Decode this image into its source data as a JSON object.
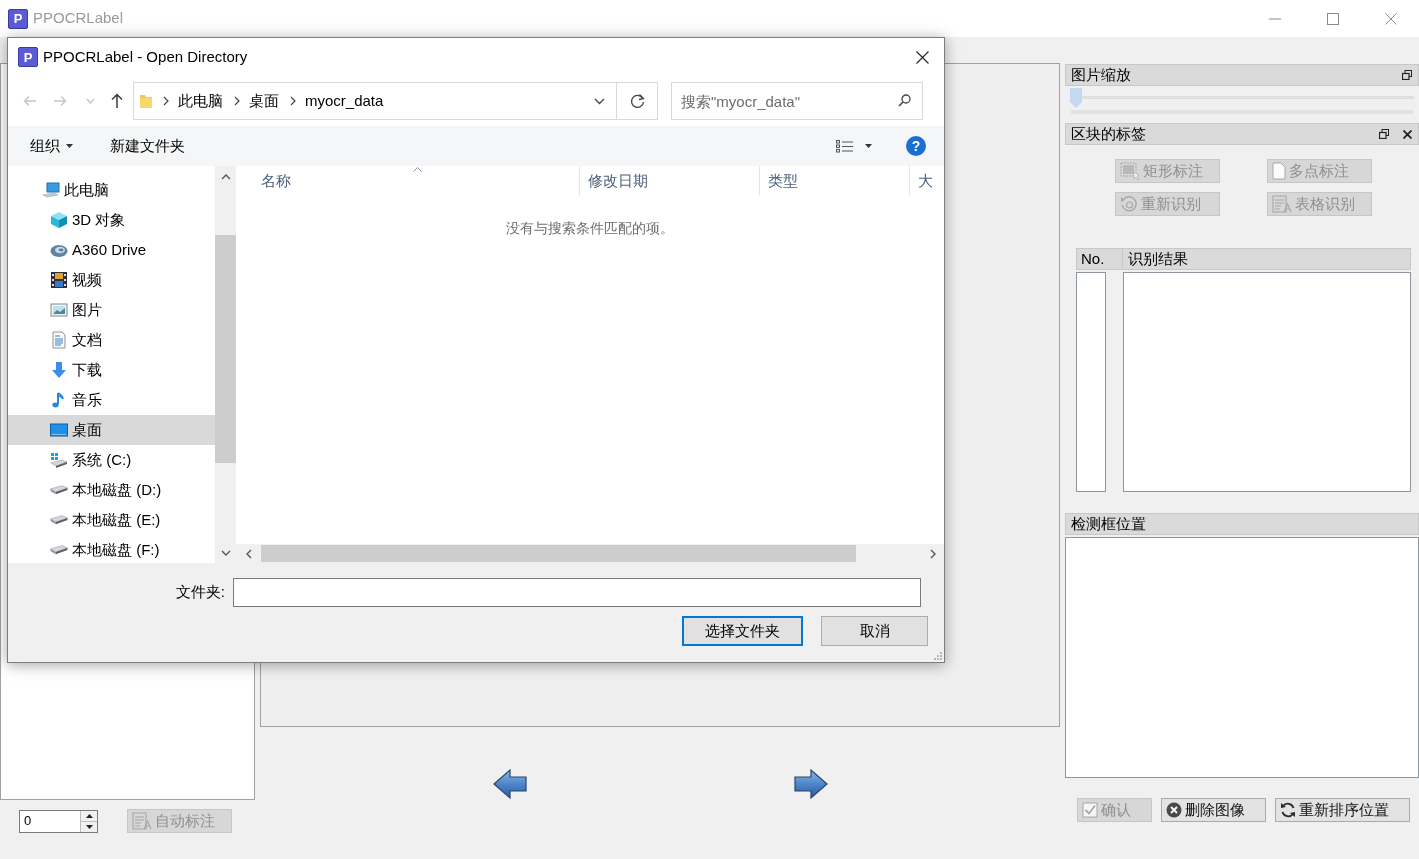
{
  "window": {
    "logo": "P",
    "title": "PPOCRLabel"
  },
  "left_panel": {
    "spinbox_value": "0",
    "auto_button": {
      "label": "自动标注",
      "disabled": true
    }
  },
  "right_panel": {
    "zoom_dock": {
      "title": "图片缩放",
      "level": 0
    },
    "labels_dock": {
      "title": "区块的标签",
      "buttons": [
        {
          "label": "矩形标注",
          "kind": "rect",
          "disabled": true
        },
        {
          "label": "多点标注",
          "kind": "poly",
          "disabled": true
        },
        {
          "label": "重新识别",
          "kind": "reocr",
          "disabled": true
        },
        {
          "label": "表格识别",
          "kind": "table",
          "disabled": true
        }
      ],
      "columns": [
        "No.",
        "识别结果"
      ]
    },
    "box_dock": {
      "title": "检测框位置"
    },
    "buttons": [
      {
        "label": "确认",
        "kind": "check",
        "disabled": true
      },
      {
        "label": "删除图像",
        "kind": "delete",
        "disabled": false
      },
      {
        "label": "重新排序位置",
        "kind": "resort",
        "disabled": false
      }
    ]
  },
  "dialog": {
    "logo": "P",
    "title": "PPOCRLabel - Open Directory",
    "nav_buttons": [
      {
        "kind": "back",
        "disabled": true
      },
      {
        "kind": "forward",
        "disabled": true
      },
      {
        "kind": "recent",
        "disabled": true
      },
      {
        "kind": "up",
        "disabled": false
      }
    ],
    "breadcrumb": [
      "此电脑",
      "桌面",
      "myocr_data"
    ],
    "search": {
      "placeholder": "搜索\"myocr_data\""
    },
    "toolbar": {
      "organize": "组织",
      "new_folder": "新建文件夹",
      "help": "?"
    },
    "nav": [
      {
        "label": "此电脑",
        "kind": "computer",
        "selected": false,
        "children": [
          {
            "label": "3D 对象",
            "kind": "cube",
            "selected": false
          },
          {
            "label": "A360 Drive",
            "kind": "cloud",
            "selected": false
          },
          {
            "label": "视频",
            "kind": "video",
            "selected": false
          },
          {
            "label": "图片",
            "kind": "pictures",
            "selected": false
          },
          {
            "label": "文档",
            "kind": "documents",
            "selected": false
          },
          {
            "label": "下载",
            "kind": "downloads",
            "selected": false
          },
          {
            "label": "音乐",
            "kind": "music",
            "selected": false
          },
          {
            "label": "桌面",
            "kind": "desktop",
            "selected": true
          },
          {
            "label": "系统 (C:)",
            "kind": "system-drive",
            "selected": false
          },
          {
            "label": "本地磁盘 (D:)",
            "kind": "drive",
            "selected": false
          },
          {
            "label": "本地磁盘 (E:)",
            "kind": "drive",
            "selected": false
          },
          {
            "label": "本地磁盘 (F:)",
            "kind": "drive",
            "selected": false
          }
        ]
      }
    ],
    "columns": [
      "名称",
      "修改日期",
      "类型",
      "大"
    ],
    "empty_message": "没有与搜索条件匹配的项。",
    "folder_field": {
      "label": "文件夹:"
    },
    "buttons": [
      {
        "label": "选择文件夹",
        "default": true
      },
      {
        "label": "取消",
        "default": false
      }
    ]
  }
}
